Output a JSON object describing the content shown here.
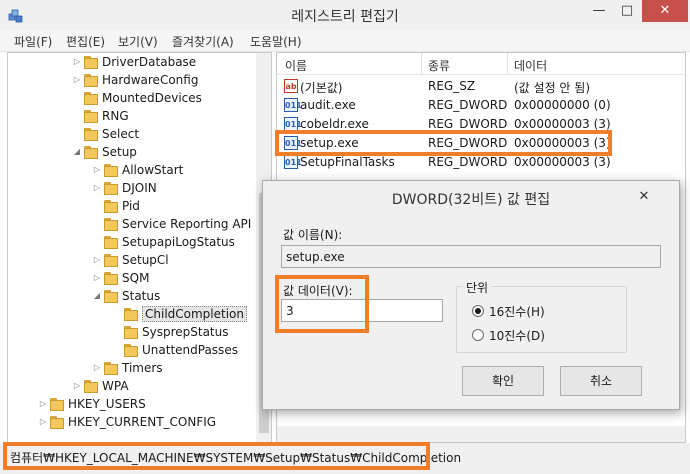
{
  "window": {
    "title": "레지스트리 편집기",
    "minimize_glyph": "—",
    "maximize_glyph": "□",
    "close_glyph": "✕",
    "icon": "registry-editor-icon"
  },
  "menu": [
    {
      "label": "파일(F)"
    },
    {
      "label": "편집(E)"
    },
    {
      "label": "보기(V)"
    },
    {
      "label": "즐겨찾기(A)"
    },
    {
      "label": "도움말(H)"
    }
  ],
  "tree": [
    {
      "label": "DriverDatabase",
      "expander": "▷"
    },
    {
      "label": "HardwareConfig",
      "expander": "▷"
    },
    {
      "label": "MountedDevices",
      "expander": ""
    },
    {
      "label": "RNG",
      "expander": ""
    },
    {
      "label": "Select",
      "expander": ""
    },
    {
      "label": "Setup",
      "expander": "◢"
    },
    {
      "label": "AllowStart",
      "expander": "▷"
    },
    {
      "label": "DJOIN",
      "expander": "▷"
    },
    {
      "label": "Pid",
      "expander": ""
    },
    {
      "label": "Service Reporting API",
      "expander": ""
    },
    {
      "label": "SetupapiLogStatus",
      "expander": ""
    },
    {
      "label": "SetupCl",
      "expander": "▷"
    },
    {
      "label": "SQM",
      "expander": "▷"
    },
    {
      "label": "Status",
      "expander": "◢"
    },
    {
      "label": "ChildCompletion",
      "expander": "",
      "selected": true
    },
    {
      "label": "SysprepStatus",
      "expander": ""
    },
    {
      "label": "UnattendPasses",
      "expander": ""
    },
    {
      "label": "Timers",
      "expander": "▷"
    },
    {
      "label": "WPA",
      "expander": "▷"
    },
    {
      "label": "HKEY_USERS",
      "expander": "▷"
    },
    {
      "label": "HKEY_CURRENT_CONFIG",
      "expander": "▷"
    }
  ],
  "list": {
    "columns": [
      "이름",
      "종류",
      "데이터"
    ],
    "rows": [
      {
        "name": "(기본값)",
        "type": "REG_SZ",
        "data": "(값 설정 안 됨)",
        "icon": "ab"
      },
      {
        "name": "audit.exe",
        "type": "REG_DWORD",
        "data": "0x00000000 (0)",
        "icon": "011"
      },
      {
        "name": "cobeldr.exe",
        "type": "REG_DWORD",
        "data": "0x00000003 (3)",
        "icon": "011"
      },
      {
        "name": "setup.exe",
        "type": "REG_DWORD",
        "data": "0x00000003 (3)",
        "icon": "011"
      },
      {
        "name": "SetupFinalTasks",
        "type": "REG_DWORD",
        "data": "0x00000003 (3)",
        "icon": "011"
      }
    ]
  },
  "status": {
    "path": "컴퓨터₩HKEY_LOCAL_MACHINE₩SYSTEM₩Setup₩Status₩ChildCompletion"
  },
  "dialog": {
    "title": "DWORD(32비트) 값 편집",
    "close_glyph": "✕",
    "name_label": "값 이름(N):",
    "name_value": "setup.exe",
    "data_label": "값 데이터(V):",
    "data_value": "3",
    "base_label": "단위",
    "hex_label": "16진수(H)",
    "dec_label": "10진수(D)",
    "ok": "확인",
    "cancel": "취소"
  },
  "colors": {
    "highlight": "#f07d2a",
    "close_button": "#c7504c"
  }
}
